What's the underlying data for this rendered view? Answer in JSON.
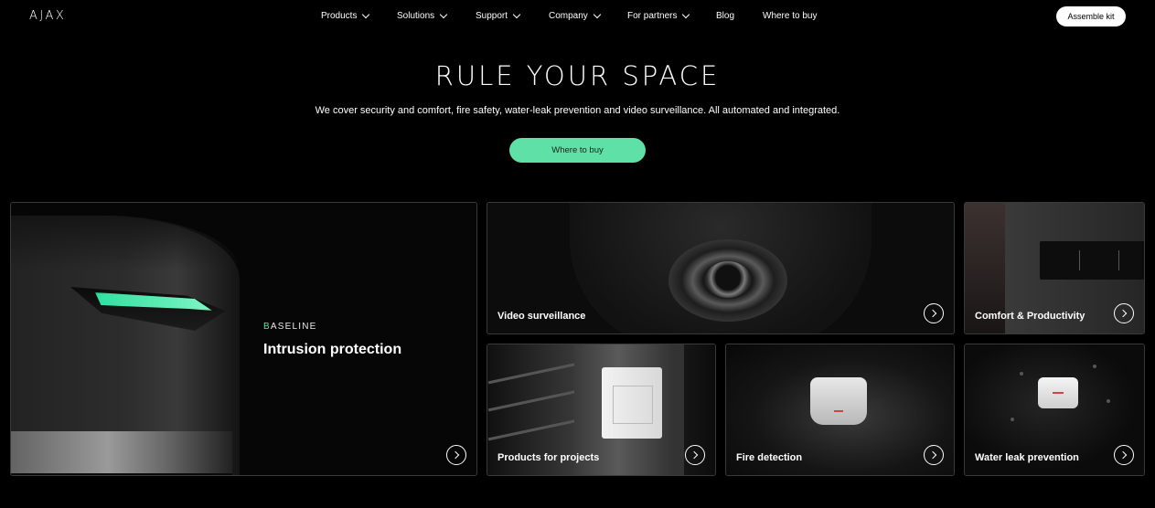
{
  "header": {
    "logo": "AJAX",
    "nav": [
      {
        "label": "Products",
        "dropdown": true
      },
      {
        "label": "Solutions",
        "dropdown": true
      },
      {
        "label": "Support",
        "dropdown": true
      },
      {
        "label": "Company",
        "dropdown": true
      },
      {
        "label": "For partners",
        "dropdown": true
      },
      {
        "label": "Blog",
        "dropdown": false
      },
      {
        "label": "Where to buy",
        "dropdown": false
      }
    ],
    "assemble_kit": "Assemble kit"
  },
  "hero": {
    "title": "RULE YOUR SPACE",
    "subtitle": "We cover security and comfort, fire safety, water-leak prevention and video surveillance. All automated and integrated.",
    "cta": "Where to buy"
  },
  "cards": {
    "intrusion": {
      "brand_first": "B",
      "brand_rest": "ASELINE",
      "title": "Intrusion protection"
    },
    "video": {
      "title": "Video surveillance"
    },
    "comfort": {
      "title": "Comfort & Productivity"
    },
    "projects": {
      "title": "Products for projects"
    },
    "fire": {
      "title": "Fire detection"
    },
    "water": {
      "title": "Water leak prevention"
    }
  },
  "colors": {
    "accent": "#5fe0a6",
    "background": "#000000",
    "card_border": "#3a3a3a"
  },
  "icons": {
    "card_arrow": "chevron-right-circle-icon",
    "nav_dropdown": "chevron-down-icon"
  }
}
